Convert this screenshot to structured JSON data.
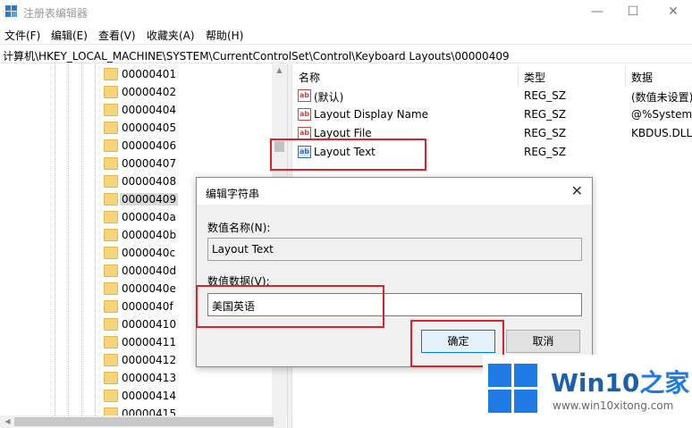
{
  "window": {
    "title": "注册表编辑器",
    "minimize": "—",
    "maximize": "☐",
    "close": "✕"
  },
  "menu": [
    "文件(F)",
    "编辑(E)",
    "查看(V)",
    "收藏夹(A)",
    "帮助(H)"
  ],
  "address": "计算机\\HKEY_LOCAL_MACHINE\\SYSTEM\\CurrentControlSet\\Control\\Keyboard Layouts\\00000409",
  "tree": {
    "items": [
      "00000401",
      "00000402",
      "00000404",
      "00000405",
      "00000406",
      "00000407",
      "00000408",
      "00000409",
      "0000040a",
      "0000040b",
      "0000040c",
      "0000040d",
      "0000040e",
      "0000040f",
      "00000410",
      "00000411",
      "00000412",
      "00000413",
      "00000414",
      "00000415"
    ],
    "selected": "00000409"
  },
  "list": {
    "columns": [
      "名称",
      "类型",
      "数据"
    ],
    "rows": [
      {
        "name": "(默认)",
        "type": "REG_SZ",
        "data": "(数值未设置)"
      },
      {
        "name": "Layout Display Name",
        "type": "REG_SZ",
        "data": "@%SystemR"
      },
      {
        "name": "Layout File",
        "type": "REG_SZ",
        "data": "KBDUS.DLL"
      },
      {
        "name": "Layout Text",
        "type": "REG_SZ",
        "data": ""
      }
    ],
    "icon_text": "ab"
  },
  "dialog": {
    "title": "编辑字符串",
    "close": "✕",
    "name_label": "数值名称(N):",
    "name_value": "Layout Text",
    "data_label": "数值数据(V):",
    "data_value": "美国英语",
    "ok": "确定",
    "cancel": "取消"
  },
  "logo": {
    "brand_a": "Win10",
    "brand_b": "之家",
    "url": "www.win10xitong.com"
  },
  "colors": {
    "highlight": "#e0202a",
    "accent": "#0078d7",
    "brand": "#1f7be3"
  }
}
